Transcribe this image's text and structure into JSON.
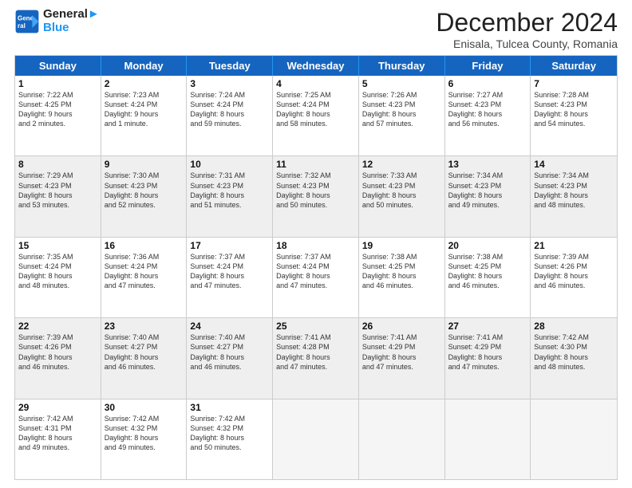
{
  "header": {
    "logo_line1": "General",
    "logo_line2": "Blue",
    "month_title": "December 2024",
    "subtitle": "Enisala, Tulcea County, Romania"
  },
  "days_of_week": [
    "Sunday",
    "Monday",
    "Tuesday",
    "Wednesday",
    "Thursday",
    "Friday",
    "Saturday"
  ],
  "rows": [
    [
      {
        "day": "1",
        "lines": [
          "Sunrise: 7:22 AM",
          "Sunset: 4:25 PM",
          "Daylight: 9 hours",
          "and 2 minutes."
        ]
      },
      {
        "day": "2",
        "lines": [
          "Sunrise: 7:23 AM",
          "Sunset: 4:24 PM",
          "Daylight: 9 hours",
          "and 1 minute."
        ]
      },
      {
        "day": "3",
        "lines": [
          "Sunrise: 7:24 AM",
          "Sunset: 4:24 PM",
          "Daylight: 8 hours",
          "and 59 minutes."
        ]
      },
      {
        "day": "4",
        "lines": [
          "Sunrise: 7:25 AM",
          "Sunset: 4:24 PM",
          "Daylight: 8 hours",
          "and 58 minutes."
        ]
      },
      {
        "day": "5",
        "lines": [
          "Sunrise: 7:26 AM",
          "Sunset: 4:23 PM",
          "Daylight: 8 hours",
          "and 57 minutes."
        ]
      },
      {
        "day": "6",
        "lines": [
          "Sunrise: 7:27 AM",
          "Sunset: 4:23 PM",
          "Daylight: 8 hours",
          "and 56 minutes."
        ]
      },
      {
        "day": "7",
        "lines": [
          "Sunrise: 7:28 AM",
          "Sunset: 4:23 PM",
          "Daylight: 8 hours",
          "and 54 minutes."
        ]
      }
    ],
    [
      {
        "day": "8",
        "lines": [
          "Sunrise: 7:29 AM",
          "Sunset: 4:23 PM",
          "Daylight: 8 hours",
          "and 53 minutes."
        ],
        "shaded": true
      },
      {
        "day": "9",
        "lines": [
          "Sunrise: 7:30 AM",
          "Sunset: 4:23 PM",
          "Daylight: 8 hours",
          "and 52 minutes."
        ],
        "shaded": true
      },
      {
        "day": "10",
        "lines": [
          "Sunrise: 7:31 AM",
          "Sunset: 4:23 PM",
          "Daylight: 8 hours",
          "and 51 minutes."
        ],
        "shaded": true
      },
      {
        "day": "11",
        "lines": [
          "Sunrise: 7:32 AM",
          "Sunset: 4:23 PM",
          "Daylight: 8 hours",
          "and 50 minutes."
        ],
        "shaded": true
      },
      {
        "day": "12",
        "lines": [
          "Sunrise: 7:33 AM",
          "Sunset: 4:23 PM",
          "Daylight: 8 hours",
          "and 50 minutes."
        ],
        "shaded": true
      },
      {
        "day": "13",
        "lines": [
          "Sunrise: 7:34 AM",
          "Sunset: 4:23 PM",
          "Daylight: 8 hours",
          "and 49 minutes."
        ],
        "shaded": true
      },
      {
        "day": "14",
        "lines": [
          "Sunrise: 7:34 AM",
          "Sunset: 4:23 PM",
          "Daylight: 8 hours",
          "and 48 minutes."
        ],
        "shaded": true
      }
    ],
    [
      {
        "day": "15",
        "lines": [
          "Sunrise: 7:35 AM",
          "Sunset: 4:24 PM",
          "Daylight: 8 hours",
          "and 48 minutes."
        ]
      },
      {
        "day": "16",
        "lines": [
          "Sunrise: 7:36 AM",
          "Sunset: 4:24 PM",
          "Daylight: 8 hours",
          "and 47 minutes."
        ]
      },
      {
        "day": "17",
        "lines": [
          "Sunrise: 7:37 AM",
          "Sunset: 4:24 PM",
          "Daylight: 8 hours",
          "and 47 minutes."
        ]
      },
      {
        "day": "18",
        "lines": [
          "Sunrise: 7:37 AM",
          "Sunset: 4:24 PM",
          "Daylight: 8 hours",
          "and 47 minutes."
        ]
      },
      {
        "day": "19",
        "lines": [
          "Sunrise: 7:38 AM",
          "Sunset: 4:25 PM",
          "Daylight: 8 hours",
          "and 46 minutes."
        ]
      },
      {
        "day": "20",
        "lines": [
          "Sunrise: 7:38 AM",
          "Sunset: 4:25 PM",
          "Daylight: 8 hours",
          "and 46 minutes."
        ]
      },
      {
        "day": "21",
        "lines": [
          "Sunrise: 7:39 AM",
          "Sunset: 4:26 PM",
          "Daylight: 8 hours",
          "and 46 minutes."
        ]
      }
    ],
    [
      {
        "day": "22",
        "lines": [
          "Sunrise: 7:39 AM",
          "Sunset: 4:26 PM",
          "Daylight: 8 hours",
          "and 46 minutes."
        ],
        "shaded": true
      },
      {
        "day": "23",
        "lines": [
          "Sunrise: 7:40 AM",
          "Sunset: 4:27 PM",
          "Daylight: 8 hours",
          "and 46 minutes."
        ],
        "shaded": true
      },
      {
        "day": "24",
        "lines": [
          "Sunrise: 7:40 AM",
          "Sunset: 4:27 PM",
          "Daylight: 8 hours",
          "and 46 minutes."
        ],
        "shaded": true
      },
      {
        "day": "25",
        "lines": [
          "Sunrise: 7:41 AM",
          "Sunset: 4:28 PM",
          "Daylight: 8 hours",
          "and 47 minutes."
        ],
        "shaded": true
      },
      {
        "day": "26",
        "lines": [
          "Sunrise: 7:41 AM",
          "Sunset: 4:29 PM",
          "Daylight: 8 hours",
          "and 47 minutes."
        ],
        "shaded": true
      },
      {
        "day": "27",
        "lines": [
          "Sunrise: 7:41 AM",
          "Sunset: 4:29 PM",
          "Daylight: 8 hours",
          "and 47 minutes."
        ],
        "shaded": true
      },
      {
        "day": "28",
        "lines": [
          "Sunrise: 7:42 AM",
          "Sunset: 4:30 PM",
          "Daylight: 8 hours",
          "and 48 minutes."
        ],
        "shaded": true
      }
    ],
    [
      {
        "day": "29",
        "lines": [
          "Sunrise: 7:42 AM",
          "Sunset: 4:31 PM",
          "Daylight: 8 hours",
          "and 49 minutes."
        ]
      },
      {
        "day": "30",
        "lines": [
          "Sunrise: 7:42 AM",
          "Sunset: 4:32 PM",
          "Daylight: 8 hours",
          "and 49 minutes."
        ]
      },
      {
        "day": "31",
        "lines": [
          "Sunrise: 7:42 AM",
          "Sunset: 4:32 PM",
          "Daylight: 8 hours",
          "and 50 minutes."
        ]
      },
      {
        "day": "",
        "lines": [],
        "empty": true
      },
      {
        "day": "",
        "lines": [],
        "empty": true
      },
      {
        "day": "",
        "lines": [],
        "empty": true
      },
      {
        "day": "",
        "lines": [],
        "empty": true
      }
    ]
  ]
}
